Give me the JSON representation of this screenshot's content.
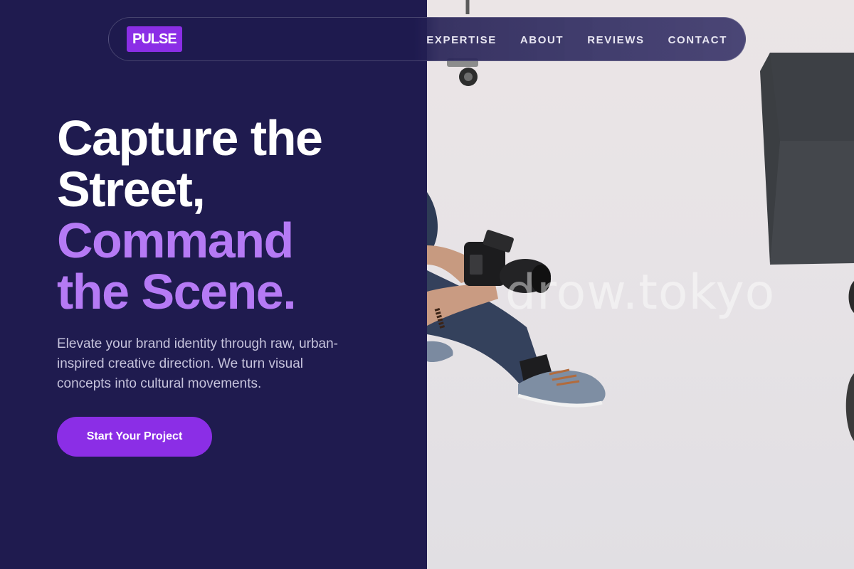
{
  "nav": {
    "logo": "PULSE",
    "links": [
      "EXPERTISE",
      "ABOUT",
      "REVIEWS",
      "CONTACT"
    ]
  },
  "hero": {
    "title_line1": "Capture the",
    "title_line2": "Street,",
    "title_line3": "Command",
    "title_line4": "the Scene.",
    "description": "Elevate your brand identity through raw, urban-inspired creative direction. We turn visual concepts into cultural movements.",
    "cta_label": "Start Your Project"
  },
  "photo": {
    "watermark": "drow.tokyo"
  },
  "colors": {
    "background": "#1f1b4f",
    "accent": "#8b2ee6",
    "headline_accent": "#b57af5",
    "text": "#ffffff",
    "muted_text": "#c6c3dc"
  }
}
